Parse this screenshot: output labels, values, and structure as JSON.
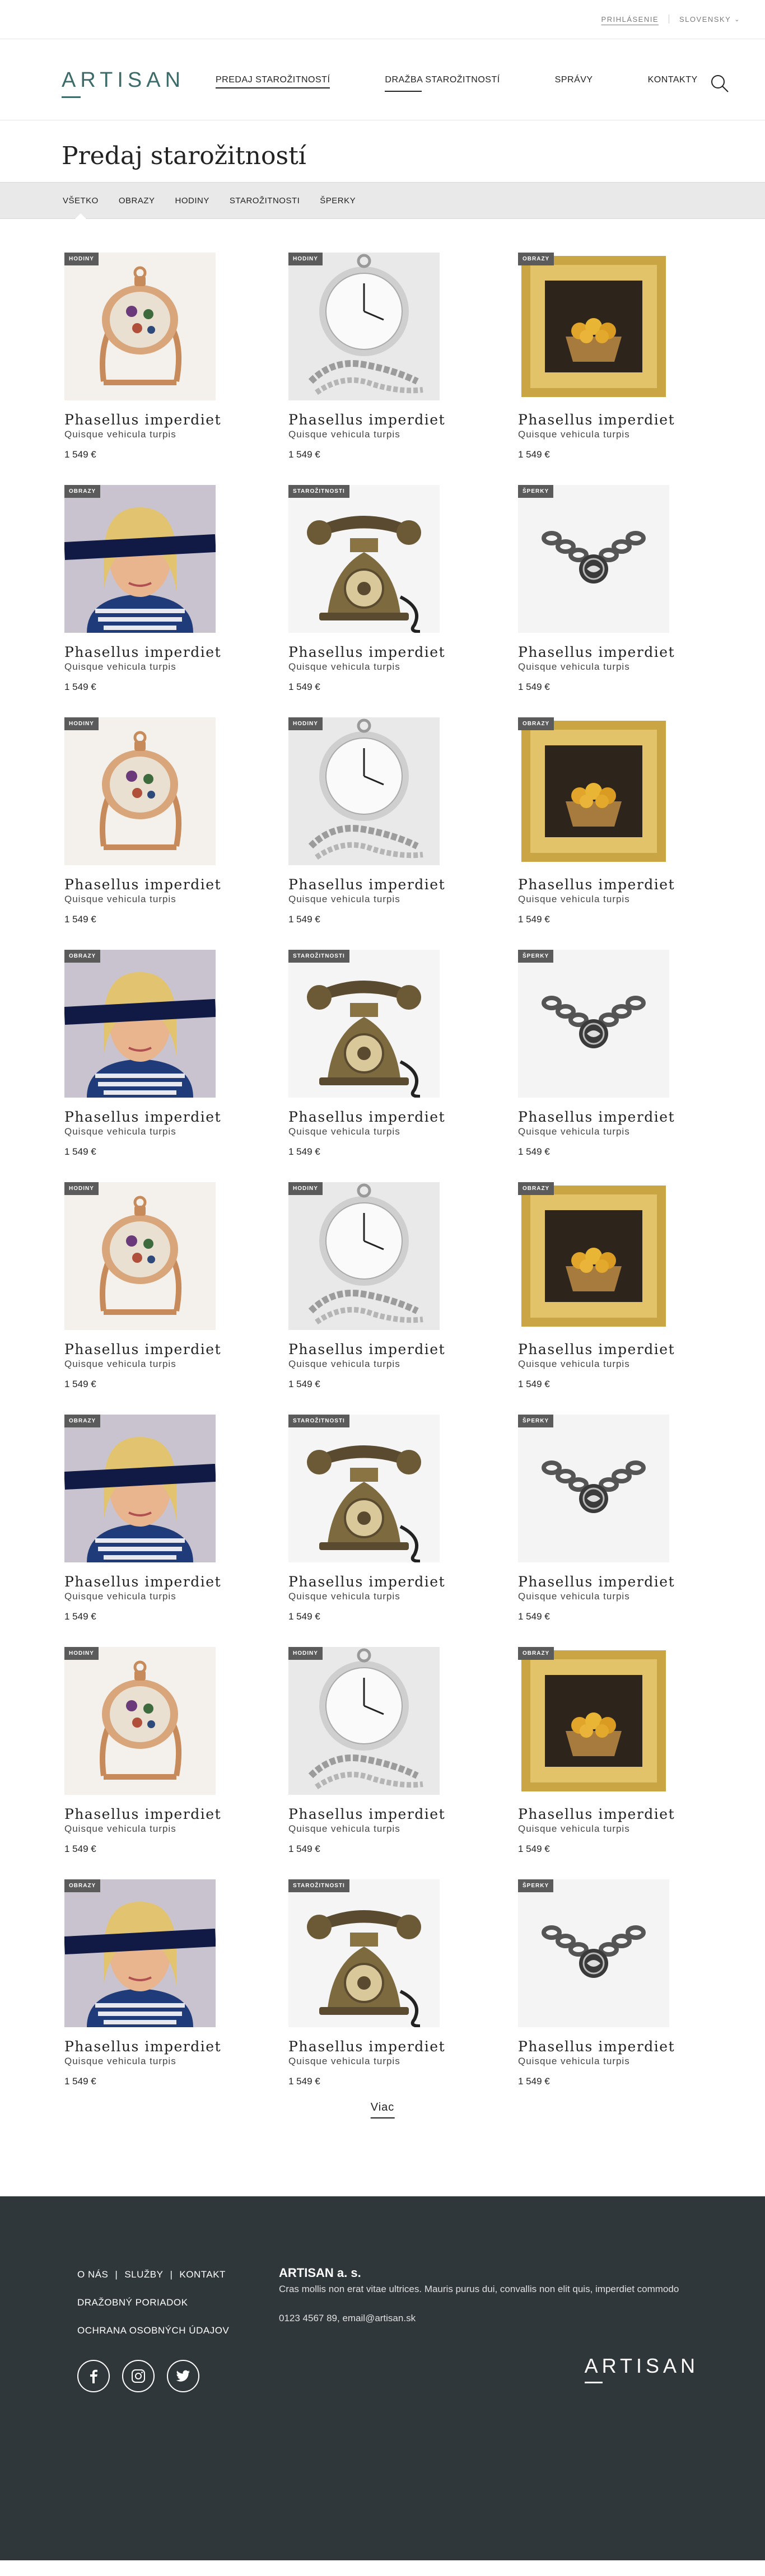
{
  "topbar": {
    "login_label": "PRIHLÁSENIE",
    "language_label": "SLOVENSKY"
  },
  "header": {
    "logo": "ARTISAN",
    "nav": [
      {
        "label": "PREDAJ STAROŽITNOSTÍ",
        "active": true
      },
      {
        "label": "DRAŽBA STAROŽITNOSTÍ",
        "active": false
      },
      {
        "label": "SPRÁVY",
        "active": false
      },
      {
        "label": "KONTAKTY",
        "active": false
      }
    ]
  },
  "page": {
    "title": "Predaj starožitností"
  },
  "filters": [
    {
      "label": "VŠETKO",
      "active": true
    },
    {
      "label": "OBRAZY",
      "active": false
    },
    {
      "label": "HODINY",
      "active": false
    },
    {
      "label": "STAROŽITNOSTI",
      "active": false
    },
    {
      "label": "ŠPERKY",
      "active": false
    }
  ],
  "products": [
    {
      "badge": "HODINY",
      "image": "ornate-pocket-watch",
      "name": "Phasellus imperdiet",
      "sub": "Quisque vehicula turpis",
      "price": "1 549 €"
    },
    {
      "badge": "HODINY",
      "image": "silver-pocket-watch",
      "name": "Phasellus imperdiet",
      "sub": "Quisque vehicula turpis",
      "price": "1 549 €"
    },
    {
      "badge": "OBRAZY",
      "image": "framed-still-life",
      "name": "Phasellus imperdiet",
      "sub": "Quisque vehicula turpis",
      "price": "1 549 €"
    },
    {
      "badge": "OBRAZY",
      "image": "portrait-painting",
      "name": "Phasellus imperdiet",
      "sub": "Quisque vehicula turpis",
      "price": "1 549 €"
    },
    {
      "badge": "STAROŽITNOSTI",
      "image": "antique-telephone",
      "name": "Phasellus imperdiet",
      "sub": "Quisque vehicula turpis",
      "price": "1 549 €"
    },
    {
      "badge": "ŠPERKY",
      "image": "chain-bracelet",
      "name": "Phasellus imperdiet",
      "sub": "Quisque vehicula turpis",
      "price": "1 549 €"
    },
    {
      "badge": "HODINY",
      "image": "ornate-pocket-watch",
      "name": "Phasellus imperdiet",
      "sub": "Quisque vehicula turpis",
      "price": "1 549 €"
    },
    {
      "badge": "HODINY",
      "image": "silver-pocket-watch",
      "name": "Phasellus imperdiet",
      "sub": "Quisque vehicula turpis",
      "price": "1 549 €"
    },
    {
      "badge": "OBRAZY",
      "image": "framed-still-life",
      "name": "Phasellus imperdiet",
      "sub": "Quisque vehicula turpis",
      "price": "1 549 €"
    },
    {
      "badge": "OBRAZY",
      "image": "portrait-painting",
      "name": "Phasellus imperdiet",
      "sub": "Quisque vehicula turpis",
      "price": "1 549 €"
    },
    {
      "badge": "STAROŽITNOSTI",
      "image": "antique-telephone",
      "name": "Phasellus imperdiet",
      "sub": "Quisque vehicula turpis",
      "price": "1 549 €"
    },
    {
      "badge": "ŠPERKY",
      "image": "chain-bracelet",
      "name": "Phasellus imperdiet",
      "sub": "Quisque vehicula turpis",
      "price": "1 549 €"
    },
    {
      "badge": "HODINY",
      "image": "ornate-pocket-watch",
      "name": "Phasellus imperdiet",
      "sub": "Quisque vehicula turpis",
      "price": "1 549 €"
    },
    {
      "badge": "HODINY",
      "image": "silver-pocket-watch",
      "name": "Phasellus imperdiet",
      "sub": "Quisque vehicula turpis",
      "price": "1 549 €"
    },
    {
      "badge": "OBRAZY",
      "image": "framed-still-life",
      "name": "Phasellus imperdiet",
      "sub": "Quisque vehicula turpis",
      "price": "1 549 €"
    },
    {
      "badge": "OBRAZY",
      "image": "portrait-painting",
      "name": "Phasellus imperdiet",
      "sub": "Quisque vehicula turpis",
      "price": "1 549 €"
    },
    {
      "badge": "STAROŽITNOSTI",
      "image": "antique-telephone",
      "name": "Phasellus imperdiet",
      "sub": "Quisque vehicula turpis",
      "price": "1 549 €"
    },
    {
      "badge": "ŠPERKY",
      "image": "chain-bracelet",
      "name": "Phasellus imperdiet",
      "sub": "Quisque vehicula turpis",
      "price": "1 549 €"
    },
    {
      "badge": "HODINY",
      "image": "ornate-pocket-watch",
      "name": "Phasellus imperdiet",
      "sub": "Quisque vehicula turpis",
      "price": "1 549 €"
    },
    {
      "badge": "HODINY",
      "image": "silver-pocket-watch",
      "name": "Phasellus imperdiet",
      "sub": "Quisque vehicula turpis",
      "price": "1 549 €"
    },
    {
      "badge": "OBRAZY",
      "image": "framed-still-life",
      "name": "Phasellus imperdiet",
      "sub": "Quisque vehicula turpis",
      "price": "1 549 €"
    },
    {
      "badge": "OBRAZY",
      "image": "portrait-painting",
      "name": "Phasellus imperdiet",
      "sub": "Quisque vehicula turpis",
      "price": "1 549 €"
    },
    {
      "badge": "STAROŽITNOSTI",
      "image": "antique-telephone",
      "name": "Phasellus imperdiet",
      "sub": "Quisque vehicula turpis",
      "price": "1 549 €"
    },
    {
      "badge": "ŠPERKY",
      "image": "chain-bracelet",
      "name": "Phasellus imperdiet",
      "sub": "Quisque vehicula turpis",
      "price": "1 549 €"
    }
  ],
  "more_label": "Viac",
  "footer": {
    "links": [
      "O NÁS",
      "SLUŽBY",
      "KONTAKT",
      "DRAŽOBNÝ PORIADOK",
      "OCHRANA OSOBNÝCH ÚDAJOV"
    ],
    "company_name": "ARTISAN a. s.",
    "company_desc": "Cras mollis non erat vitae ultrices. Mauris purus dui, convallis non elit quis, imperdiet commodo",
    "contact": "0123 4567 89, email@artisan.sk",
    "social": [
      "facebook-icon",
      "instagram-icon",
      "twitter-icon"
    ],
    "logo": "ARTISAN"
  },
  "colors": {
    "brand": "#3d6b6a",
    "badge": "#5b5b5b",
    "filter_bar": "#e9e9e9",
    "footer": "#30373a"
  }
}
